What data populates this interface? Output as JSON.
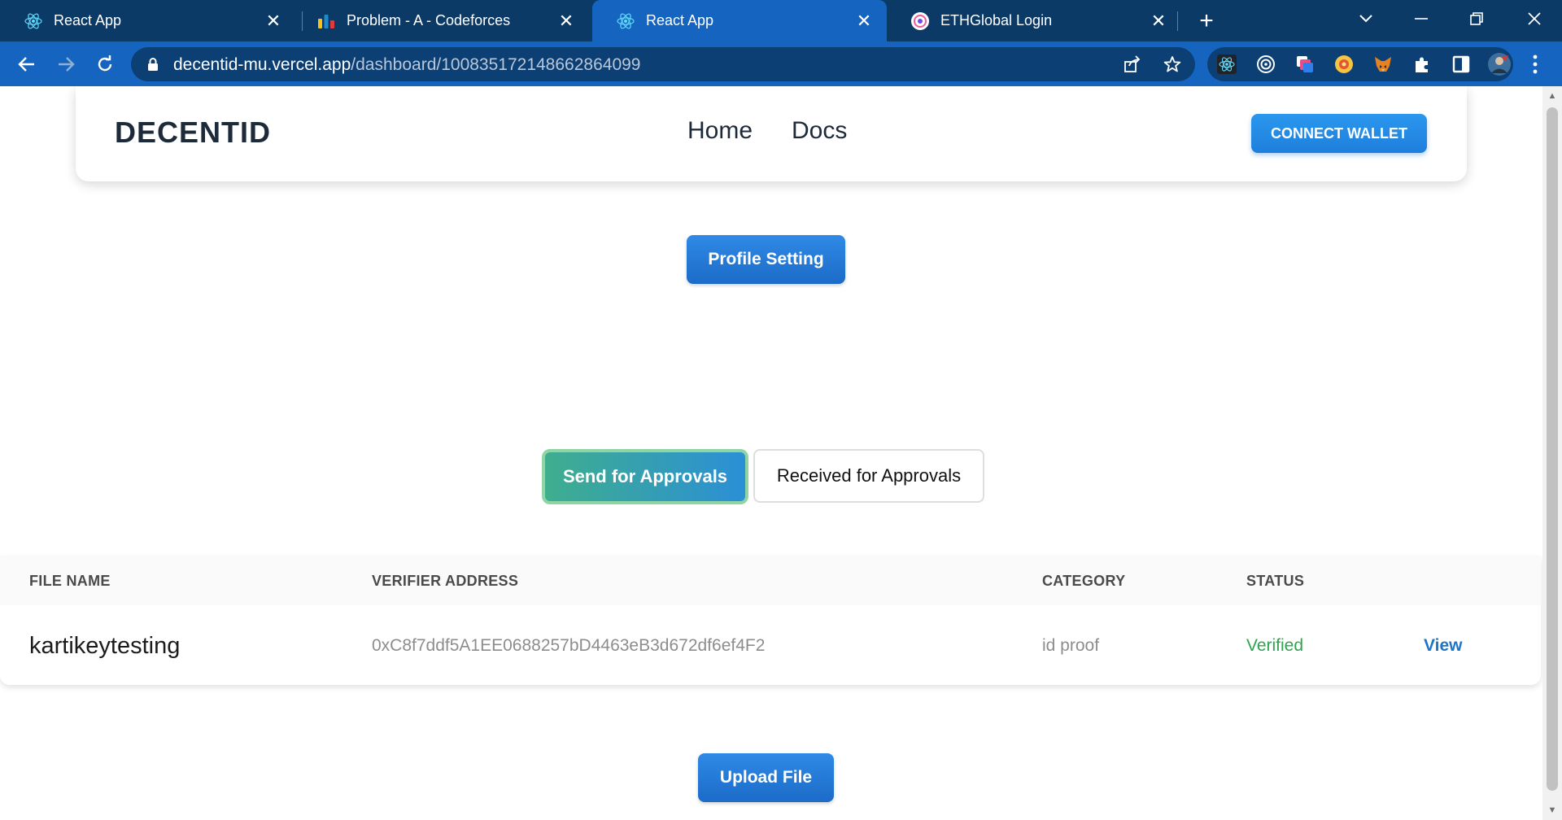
{
  "browser": {
    "tabs": [
      {
        "title": "React App",
        "favicon": "react-icon",
        "active": false
      },
      {
        "title": "Problem - A - Codeforces",
        "favicon": "codeforces-icon",
        "active": false
      },
      {
        "title": "React App",
        "favicon": "react-icon",
        "active": true
      },
      {
        "title": "ETHGlobal Login",
        "favicon": "ethglobal-icon",
        "active": false
      }
    ],
    "url_host": "decentid-mu.vercel.app",
    "url_path": "/dashboard/100835172148662864099"
  },
  "navbar": {
    "brand": "DECENTID",
    "links": [
      "Home",
      "Docs"
    ],
    "connect_wallet": "CONNECT WALLET"
  },
  "main": {
    "profile_setting": "Profile Setting",
    "toggle": {
      "send": "Send for Approvals",
      "received": "Received for Approvals"
    },
    "table": {
      "headers": [
        "FILE NAME",
        "VERIFIER ADDRESS",
        "CATEGORY",
        "STATUS"
      ],
      "rows": [
        {
          "file_name": "kartikeytesting",
          "verifier_address": "0xC8f7ddf5A1EE0688257bD4463eB3d672df6ef4F2",
          "category": "id proof",
          "status": "Verified",
          "action": "View"
        }
      ]
    },
    "upload_file": "Upload File"
  },
  "colors": {
    "chrome_dark": "#0b3a66",
    "chrome_toolbar": "#1565c0",
    "primary_button": "#1e7fdc",
    "status_verified": "#2ea44f",
    "link_view": "#1d74c9"
  }
}
